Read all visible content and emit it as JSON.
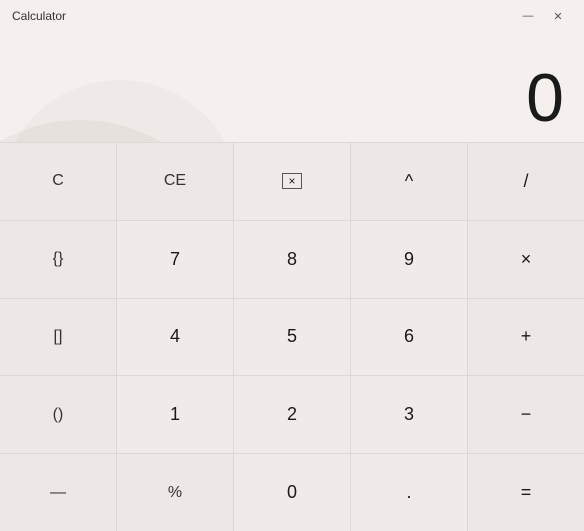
{
  "window": {
    "title": "Calculator"
  },
  "titleControls": {
    "minimize": "—",
    "close": "✕"
  },
  "display": {
    "value": "0"
  },
  "buttons": [
    [
      {
        "id": "c",
        "label": "C",
        "type": "special"
      },
      {
        "id": "ce",
        "label": "CE",
        "type": "special"
      },
      {
        "id": "backspace",
        "label": "⌫",
        "type": "backspace"
      },
      {
        "id": "power",
        "label": "^",
        "type": "operator"
      },
      {
        "id": "divide",
        "label": "/",
        "type": "operator"
      }
    ],
    [
      {
        "id": "curly",
        "label": "{}",
        "type": "special"
      },
      {
        "id": "7",
        "label": "7",
        "type": "digit"
      },
      {
        "id": "8",
        "label": "8",
        "type": "digit"
      },
      {
        "id": "9",
        "label": "9",
        "type": "digit"
      },
      {
        "id": "multiply",
        "label": "×",
        "type": "operator"
      }
    ],
    [
      {
        "id": "square",
        "label": "[]",
        "type": "special"
      },
      {
        "id": "4",
        "label": "4",
        "type": "digit"
      },
      {
        "id": "5",
        "label": "5",
        "type": "digit"
      },
      {
        "id": "6",
        "label": "6",
        "type": "digit"
      },
      {
        "id": "add",
        "label": "+",
        "type": "operator"
      }
    ],
    [
      {
        "id": "paren",
        "label": "()",
        "type": "special"
      },
      {
        "id": "1",
        "label": "1",
        "type": "digit"
      },
      {
        "id": "2",
        "label": "2",
        "type": "digit"
      },
      {
        "id": "3",
        "label": "3",
        "type": "digit"
      },
      {
        "id": "subtract",
        "label": "−",
        "type": "operator"
      }
    ],
    [
      {
        "id": "negate",
        "label": "—",
        "type": "special"
      },
      {
        "id": "percent",
        "label": "%",
        "type": "special"
      },
      {
        "id": "0",
        "label": "0",
        "type": "digit"
      },
      {
        "id": "decimal",
        "label": ".",
        "type": "digit"
      },
      {
        "id": "equals",
        "label": "=",
        "type": "operator"
      }
    ]
  ]
}
